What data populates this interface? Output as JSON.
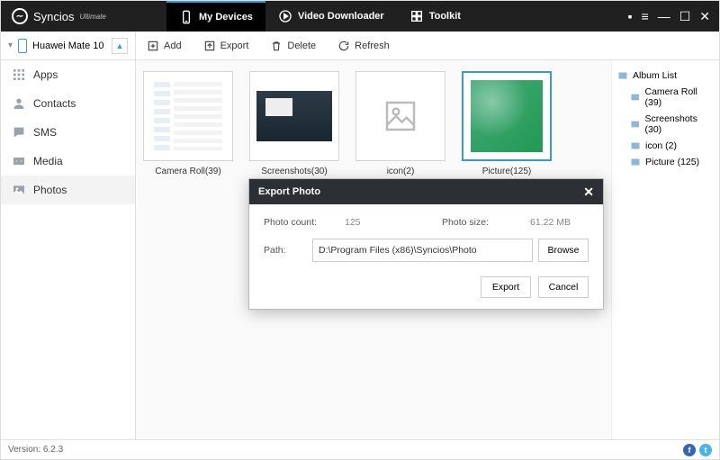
{
  "brand": {
    "name": "Syncios",
    "edition": "Ultimate"
  },
  "topTabs": {
    "devices": "My Devices",
    "downloader": "Video Downloader",
    "toolkit": "Toolkit"
  },
  "device": {
    "name": "Huawei Mate 10"
  },
  "toolbar": {
    "add": "Add",
    "export": "Export",
    "delete": "Delete",
    "refresh": "Refresh"
  },
  "sidebar": {
    "apps": "Apps",
    "contacts": "Contacts",
    "sms": "SMS",
    "media": "Media",
    "photos": "Photos"
  },
  "albums": {
    "cameraRoll": "Camera Roll(39)",
    "screenshots": "Screenshots(30)",
    "icon": "icon(2)",
    "picture": "Picture(125)"
  },
  "albumList": {
    "title": "Album List",
    "cameraRoll": "Camera Roll (39)",
    "screenshots": "Screenshots (30)",
    "icon": "icon (2)",
    "picture": "Picture (125)"
  },
  "dialog": {
    "title": "Export Photo",
    "countLabel": "Photo count:",
    "countValue": "125",
    "sizeLabel": "Photo size:",
    "sizeValue": "61.22 MB",
    "pathLabel": "Path:",
    "pathValue": "D:\\Program Files (x86)\\Syncios\\Photo",
    "browse": "Browse",
    "export": "Export",
    "cancel": "Cancel"
  },
  "status": {
    "version": "Version: 6.2.3"
  }
}
